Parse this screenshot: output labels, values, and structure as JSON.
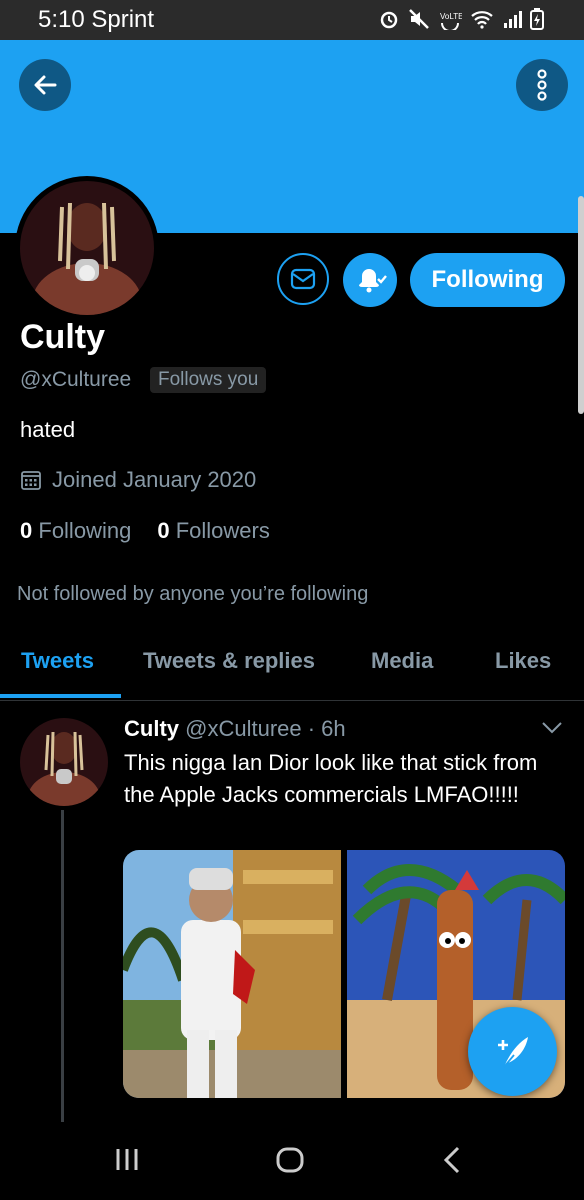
{
  "status_bar": {
    "time_carrier": "5:10 Sprint"
  },
  "icons": {
    "back": "arrow-left-icon",
    "more": "more-vertical-icon",
    "dm": "envelope-icon",
    "notif": "bell-check-icon",
    "calendar": "calendar-icon",
    "caret": "chevron-down-icon",
    "compose": "feather-plus-icon"
  },
  "colors": {
    "accent": "#1da1f2",
    "secondary_text": "#8899a6",
    "background": "#000000"
  },
  "profile": {
    "display_name": "Culty",
    "handle": "@xCulturee",
    "follows_badge": "Follows you",
    "bio": "hated",
    "joined": "Joined January 2020",
    "following_count": "0",
    "following_label": "Following",
    "followers_count": "0",
    "followers_label": "Followers",
    "not_followed_note": "Not followed by anyone you’re following",
    "follow_button": "Following"
  },
  "tabs": [
    {
      "label": "Tweets",
      "active": true
    },
    {
      "label": "Tweets & replies",
      "active": false
    },
    {
      "label": "Media",
      "active": false
    },
    {
      "label": "Likes",
      "active": false
    }
  ],
  "tweet": {
    "name": "Culty",
    "meta": "@xCulturee · 6h",
    "text": "This nigga Ian Dior look like that stick from the Apple Jacks commercials LMFAO!!!!!"
  }
}
